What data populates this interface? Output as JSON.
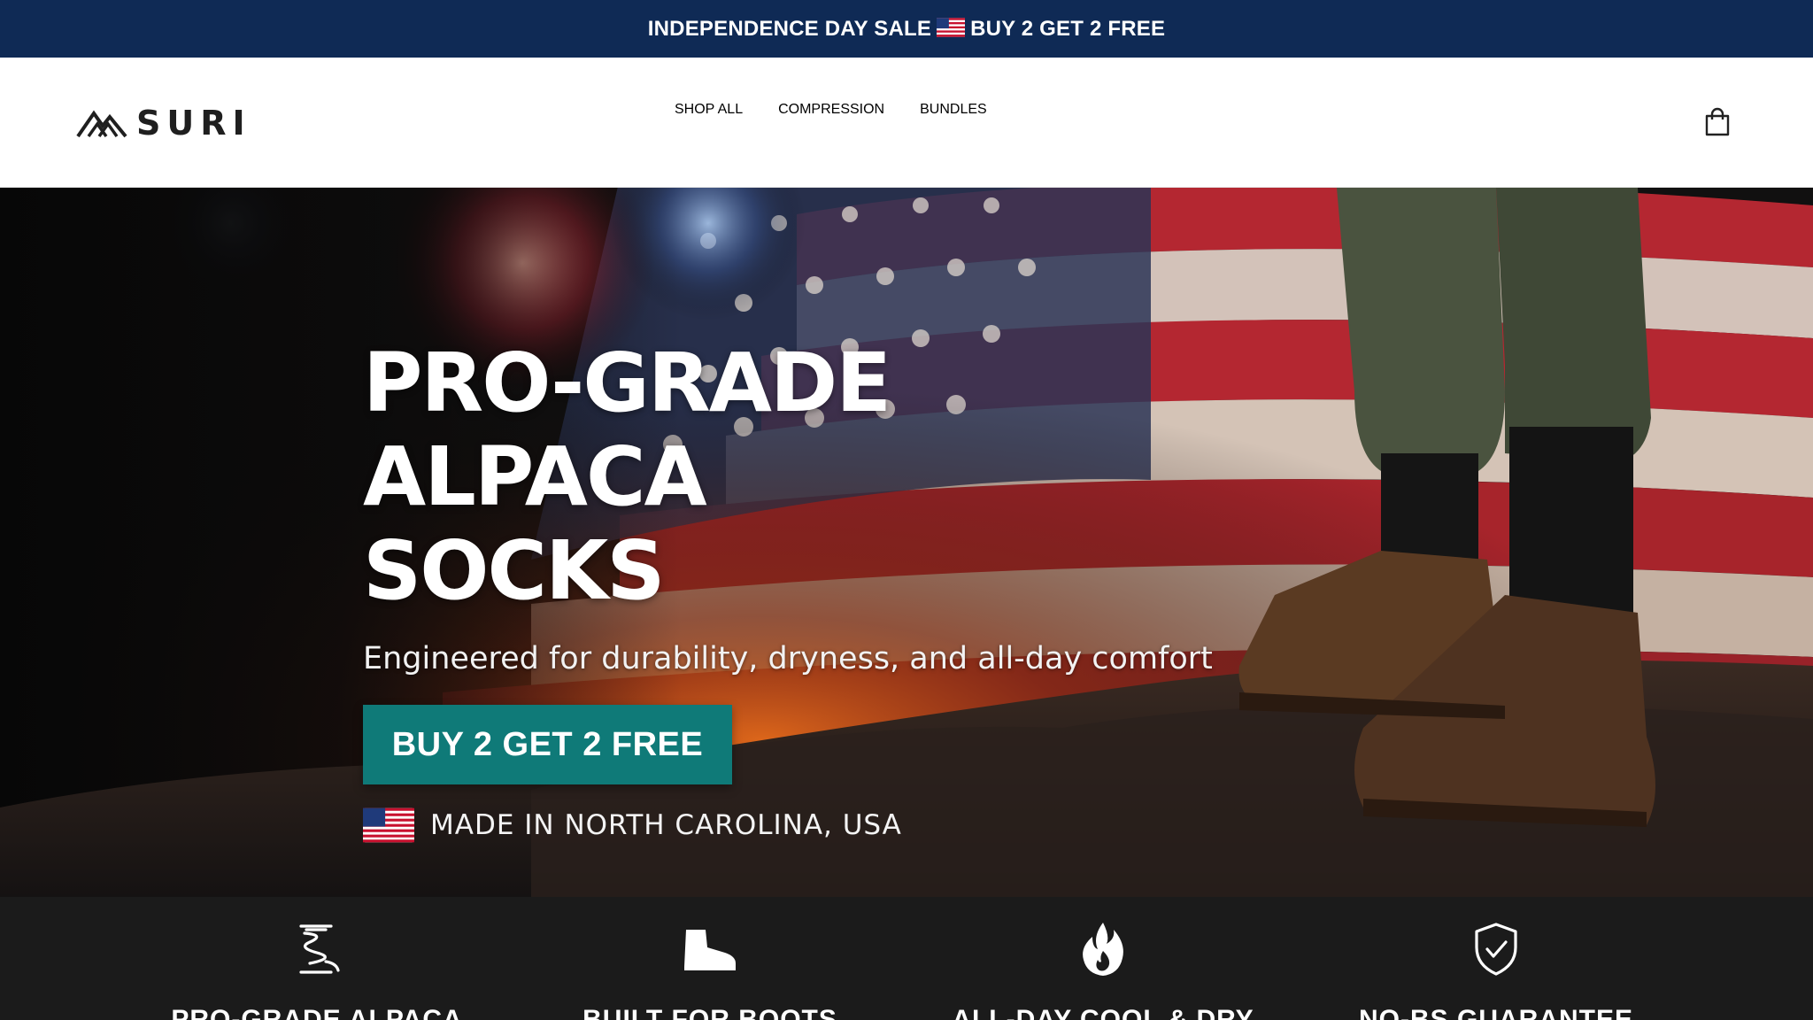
{
  "announcement": {
    "text_before": "INDEPENDENCE DAY SALE",
    "text_after": "BUY 2 GET 2 FREE",
    "flag_icon": "us-flag-icon"
  },
  "header": {
    "logo_text": "SURI",
    "nav": [
      {
        "label": "SHOP ALL"
      },
      {
        "label": "COMPRESSION"
      },
      {
        "label": "BUNDLES"
      }
    ],
    "cart_icon": "shopping-bag-icon"
  },
  "hero": {
    "title_line1": "PRO-GRADE ALPACA",
    "title_line2": "SOCKS",
    "subtitle": "Engineered for durability, dryness, and all-day comfort",
    "cta_label": "BUY 2 GET 2 FREE",
    "made_in": "MADE IN NORTH CAROLINA, USA",
    "background_description": "fireworks, american-flag, hiking-boots",
    "cta_color": "#0f7a78"
  },
  "features": [
    {
      "icon": "fiber-spool-icon",
      "label": "PRO-GRADE ALPACA"
    },
    {
      "icon": "boot-icon",
      "label": "BUILT FOR BOOTS"
    },
    {
      "icon": "flame-icon",
      "label": "ALL-DAY COOL & DRY"
    },
    {
      "icon": "shield-check-icon",
      "label": "NO-BS GUARANTEE"
    }
  ],
  "colors": {
    "announcement_bg": "#0f2a55",
    "header_bg": "#ffffff",
    "features_bg": "#1b1b1b",
    "accent": "#0f7a78"
  }
}
